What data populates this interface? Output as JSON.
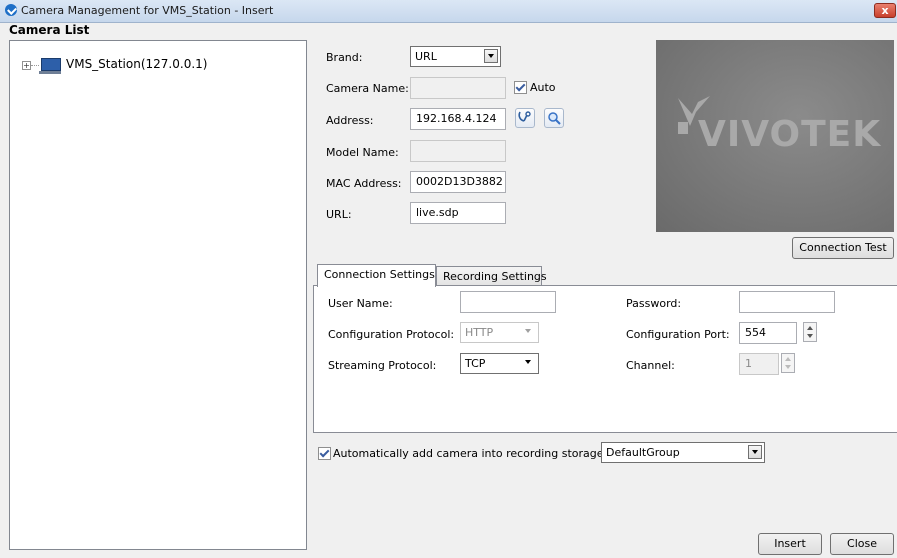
{
  "window": {
    "title": "Camera Management for VMS_Station - Insert",
    "close_glyph": "x"
  },
  "camera_list": {
    "title": "Camera List",
    "nodes": [
      {
        "label": "VMS_Station(127.0.0.1)",
        "expander": "+"
      }
    ]
  },
  "form": {
    "brand": {
      "label": "Brand:",
      "value": "URL"
    },
    "camera_name": {
      "label": "Camera Name:",
      "value": "",
      "auto_label": "Auto",
      "auto_checked": true
    },
    "address": {
      "label": "Address:",
      "value": "192.168.4.124"
    },
    "model_name": {
      "label": "Model Name:",
      "value": ""
    },
    "mac_address": {
      "label": "MAC Address:",
      "value": "0002D13D3882"
    },
    "url": {
      "label": "URL:",
      "value": "live.sdp"
    }
  },
  "preview": {
    "logo_text": "VIVOTEK"
  },
  "connection_test_label": "Connection Test",
  "tabs": [
    {
      "label": "Connection Settings",
      "active": true
    },
    {
      "label": "Recording Settings",
      "active": false
    }
  ],
  "connection": {
    "user_name": {
      "label": "User Name:",
      "value": ""
    },
    "password": {
      "label": "Password:",
      "value": ""
    },
    "config_protocol": {
      "label": "Configuration Protocol:",
      "value": "HTTP"
    },
    "config_port": {
      "label": "Configuration Port:",
      "value": "554"
    },
    "streaming_protocol": {
      "label": "Streaming Protocol:",
      "value": "TCP"
    },
    "channel": {
      "label": "Channel:",
      "value": "1"
    }
  },
  "auto_add": {
    "label": "Automatically add camera into recording storage",
    "checked": true,
    "group": "DefaultGroup"
  },
  "buttons": {
    "insert": "Insert",
    "close": "Close"
  },
  "icons": {
    "app": "vivotek-app-icon",
    "computer": "computer-icon",
    "search_network": "network-search-icon",
    "search": "magnifier-icon"
  },
  "colors": {
    "title_bar": "#c6d7ec",
    "close_button": "#c8402c",
    "preview_bg": "#7a7a7a",
    "logo": "#a9a9a9"
  }
}
